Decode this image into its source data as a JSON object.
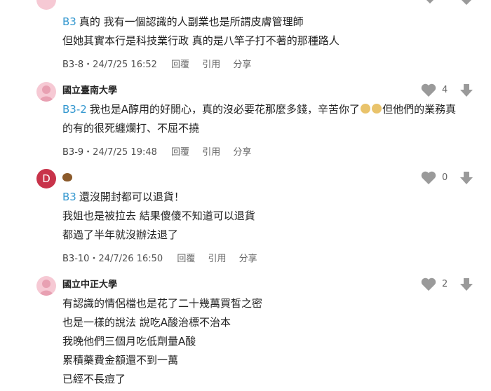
{
  "comments": [
    {
      "lines": [
        {
          "mention": "B3",
          "text": "真的 我有一個認識的人副業也是所謂皮膚管理師"
        },
        {
          "mention": "",
          "text": "但她其實本行是科技業行政 真的是八竿子打不著的那種路人"
        }
      ],
      "floor": "B3-8",
      "datetime": "24/7/25 16:52",
      "reply": "回覆",
      "quote": "引用",
      "share": "分享"
    },
    {
      "author": "國立臺南大學",
      "likes": "4",
      "line1_mention": "B3-2",
      "line1_text": "我也是A醇用的好開心，真的沒必要花那麼多錢，辛苦你了",
      "line1_after": "但他們的業務真",
      "line2_text": "的有的很死纏爛打、不屈不撓",
      "floor": "B3-9",
      "datetime": "24/7/25 19:48",
      "reply": "回覆",
      "quote": "引用",
      "share": "分享"
    },
    {
      "avatar_letter": "D",
      "author_icon": "bear-emoji",
      "likes": "0",
      "lines": [
        {
          "mention": "B3",
          "text": "還沒開封都可以退貨！"
        },
        {
          "mention": "",
          "text": "我姐也是被拉去 結果傻傻不知道可以退貨"
        },
        {
          "mention": "",
          "text": "都過了半年就沒辦法退了"
        }
      ],
      "floor": "B3-10",
      "datetime": "24/7/26 16:50",
      "reply": "回覆",
      "quote": "引用",
      "share": "分享"
    },
    {
      "author": "國立中正大學",
      "likes": "2",
      "lines": [
        "有認識的情侶檔也是花了二十幾萬買皙之密",
        "也是一樣的說法  說吃A酸治標不治本",
        "我晚他們三個月吃低劑量A酸",
        "累積藥費金額還不到一萬",
        "已經不長痘了"
      ]
    }
  ],
  "colors": {
    "mention": "#3397cf",
    "avatar_pink": "#f6c9d4",
    "avatar_d": "#c8334a",
    "icon_gray": "#9a9a9a"
  }
}
